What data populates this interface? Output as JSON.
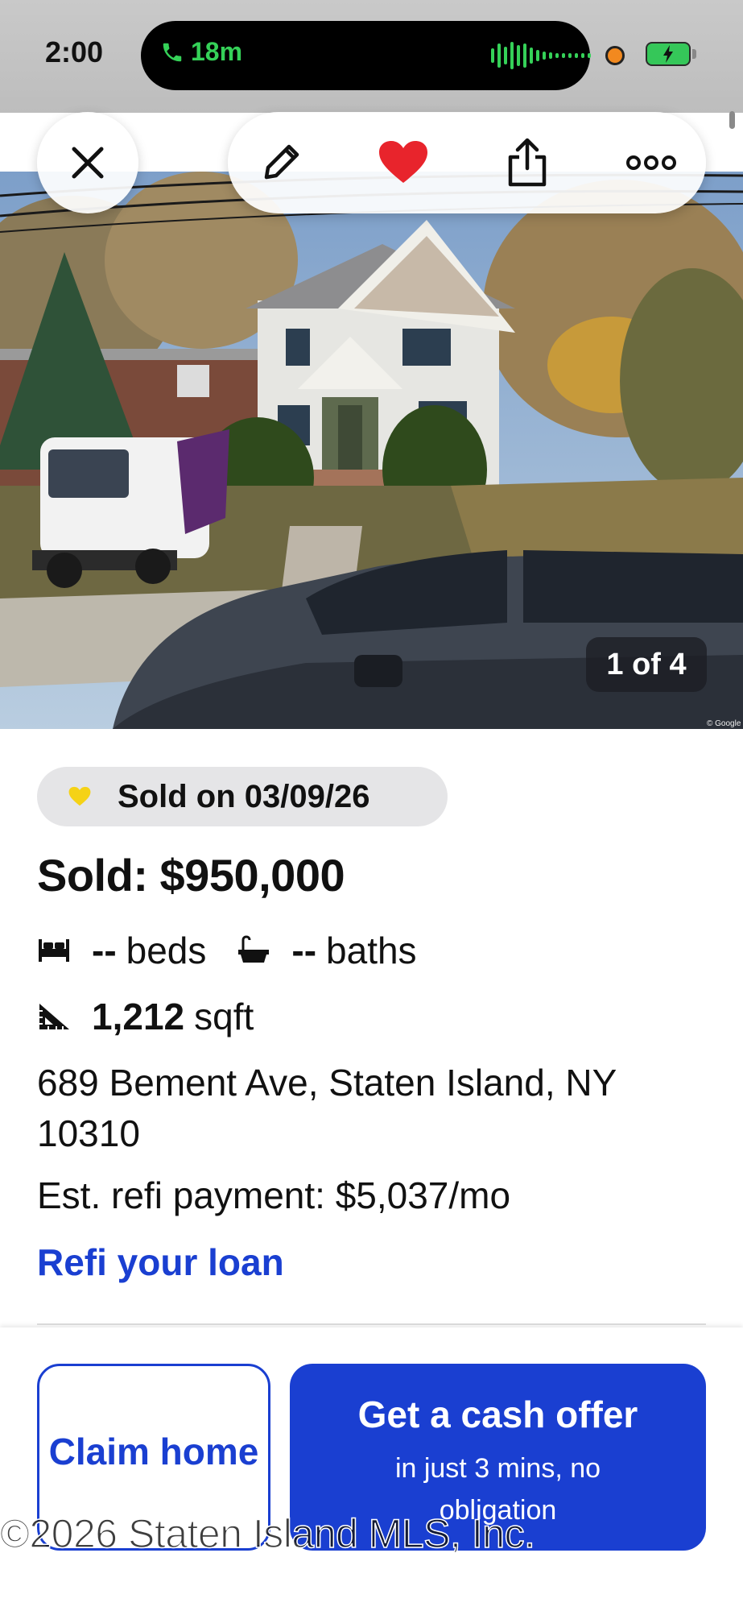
{
  "status_bar": {
    "time": "2:00",
    "call_duration": "18m",
    "colors": {
      "call_green": "#35d158",
      "recording_dot": "#f2891f"
    }
  },
  "toolbar": {
    "close_icon": "close-icon",
    "edit_icon": "pencil-icon",
    "favorite_icon": "heart-filled-icon",
    "share_icon": "share-icon",
    "more_icon": "more-icon",
    "favorite_color": "#e8242c"
  },
  "gallery": {
    "counter": "1 of 4",
    "credit": "© Google"
  },
  "listing": {
    "sold_badge": "Sold on 03/09/26",
    "sold_badge_icon": "heart-icon",
    "price": "Sold: $950,000",
    "beds_value": "--",
    "beds_label": "beds",
    "baths_value": "--",
    "baths_label": "baths",
    "sqft_value": "1,212",
    "sqft_label": "sqft",
    "address": "689 Bement Ave, Staten Island, NY 10310",
    "refi_payment": "Est. refi payment: $5,037/mo",
    "refi_link": "Refi your loan"
  },
  "actions": {
    "claim_home": "Claim home",
    "cash_offer_title": "Get a cash offer",
    "cash_offer_subtitle": "in just 3 mins, no obligation",
    "accent_color": "#1a3fd1"
  },
  "watermark": "©2026 Staten Island MLS, Inc."
}
